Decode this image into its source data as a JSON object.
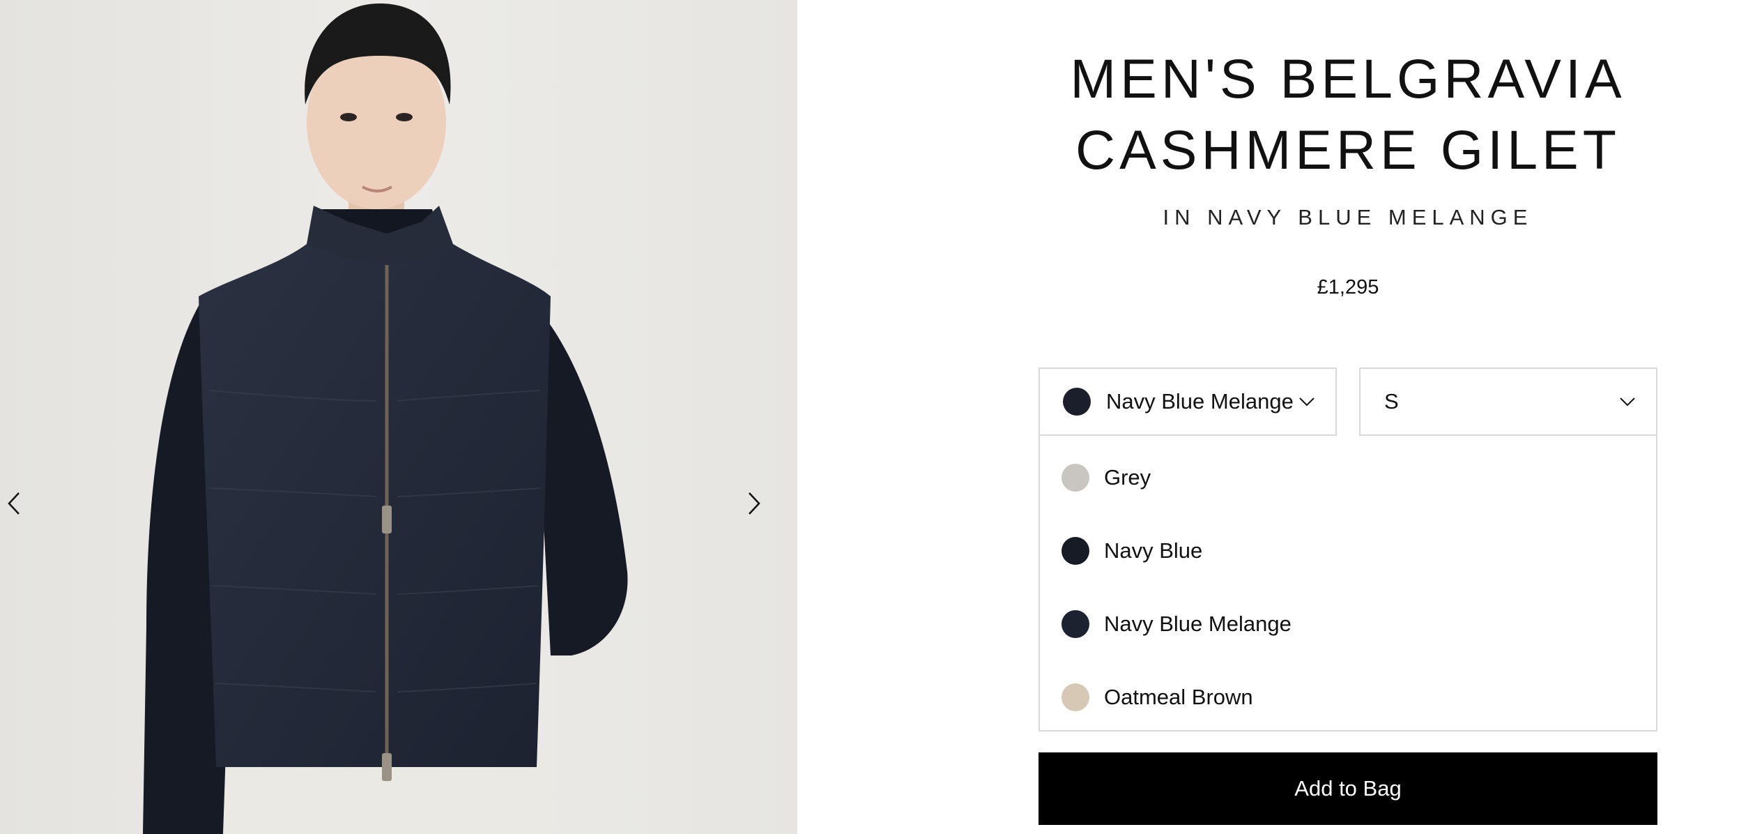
{
  "product": {
    "title": "MEN'S BELGRAVIA CASHMERE GILET",
    "subtitle": "IN NAVY BLUE MELANGE",
    "price": "£1,295"
  },
  "gallery": {
    "prev_icon": "chevron-left-icon",
    "next_icon": "chevron-right-icon"
  },
  "color_select": {
    "selected": "Navy Blue Melange",
    "selected_swatch": "#1a1f2b",
    "icon": "chevron-down-icon"
  },
  "size_select": {
    "selected": "S",
    "icon": "chevron-down-icon"
  },
  "color_options": [
    {
      "label": "Grey",
      "swatch": "#c9c6c2"
    },
    {
      "label": "Navy Blue",
      "swatch": "#161b26"
    },
    {
      "label": "Navy Blue Melange",
      "swatch": "#1d2230"
    },
    {
      "label": "Oatmeal Brown",
      "swatch": "#d6c8b5"
    }
  ],
  "cta": {
    "add_to_bag": "Add to Bag",
    "background": "#000000"
  }
}
